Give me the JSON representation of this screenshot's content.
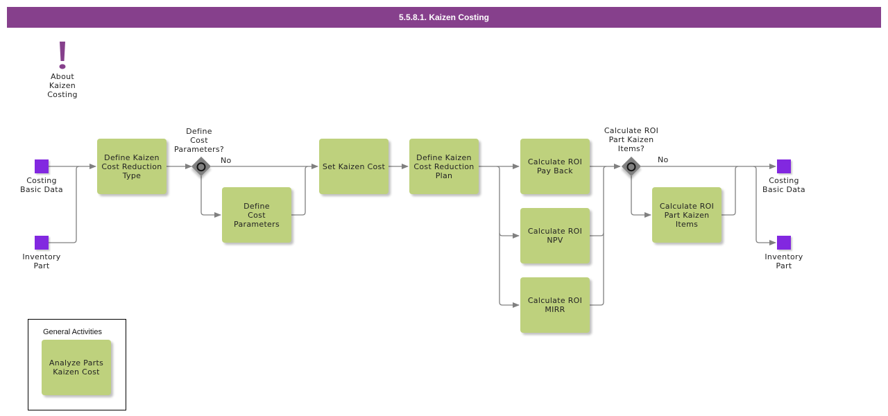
{
  "header": {
    "title": "5.5.8.1. Kaizen Costing"
  },
  "colors": {
    "header_bg": "#86408c",
    "task_fill": "#bed17d",
    "event_fill": "#8228e0",
    "gateway_fill": "#808080",
    "connector": "#808080"
  },
  "about": {
    "icon": "exclamation-icon",
    "label": "About\nKaizen\nCosting"
  },
  "start_events": [
    {
      "label": "Costing\nBasic Data"
    },
    {
      "label": "Inventory\nPart"
    }
  ],
  "end_events": [
    {
      "label": "Costing\nBasic Data"
    },
    {
      "label": "Inventory\nPart"
    }
  ],
  "tasks": {
    "define_type": "Define Kaizen\nCost Reduction\nType",
    "define_params": "Define\nCost\nParameters",
    "set_cost": "Set Kaizen Cost",
    "define_plan": "Define Kaizen\nCost Reduction\nPlan",
    "roi_payback": "Calculate ROI\nPay Back",
    "roi_npv": "Calculate ROI\nNPV",
    "roi_mirr": "Calculate ROI\nMIRR",
    "roi_part_items": "Calculate ROI\nPart Kaizen\nItems"
  },
  "gateways": [
    {
      "question": "Define\nCost\nParameters?",
      "branch_label": "No"
    },
    {
      "question": "Calculate ROI\nPart Kaizen\nItems?",
      "branch_label": "No"
    }
  ],
  "general_activities": {
    "title": "General Activities",
    "items": [
      "Analyze Parts\nKaizen Cost"
    ]
  }
}
